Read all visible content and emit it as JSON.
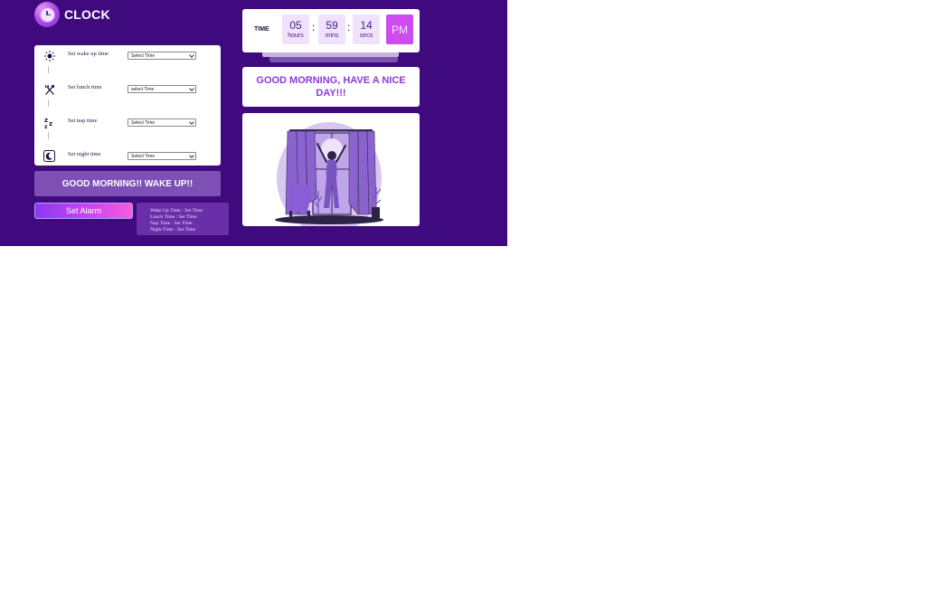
{
  "app": {
    "title": "CLOCK"
  },
  "schedule": {
    "items": [
      {
        "label": "Set wake up time",
        "select_value": "Select Time",
        "icon": "sun-icon"
      },
      {
        "label": "Set lunch time",
        "select_value": "select Time",
        "icon": "utensils-icon"
      },
      {
        "label": "Set nap time",
        "select_value": "Select Time",
        "icon": "sleep-zzz-icon"
      },
      {
        "label": "Set night time",
        "select_value": "Select Time",
        "icon": "moon-icon"
      }
    ]
  },
  "banner": {
    "message": "GOOD MORNING!! WAKE UP!!"
  },
  "buttons": {
    "set_alarm": "Set Alarm"
  },
  "summary": {
    "lines": [
      "Wake Up Time : Set Time",
      "Lunch Time : Set Time",
      "Nap Time : Set Time",
      "Night Time : Set Time"
    ]
  },
  "clock": {
    "label": "TIME",
    "hours": "05",
    "hours_unit": "hours",
    "mins": "59",
    "mins_unit": "mins",
    "secs": "14",
    "secs_unit": "secs",
    "separator": ":",
    "ampm": "PM"
  },
  "greeting": {
    "text": "GOOD MORNING, HAVE A NICE DAY!!!"
  },
  "colors": {
    "background": "#3f0a7e",
    "accent": "#cd4bf0",
    "greeting_text": "#8b3ad9",
    "banner": "#7e4fb4"
  }
}
